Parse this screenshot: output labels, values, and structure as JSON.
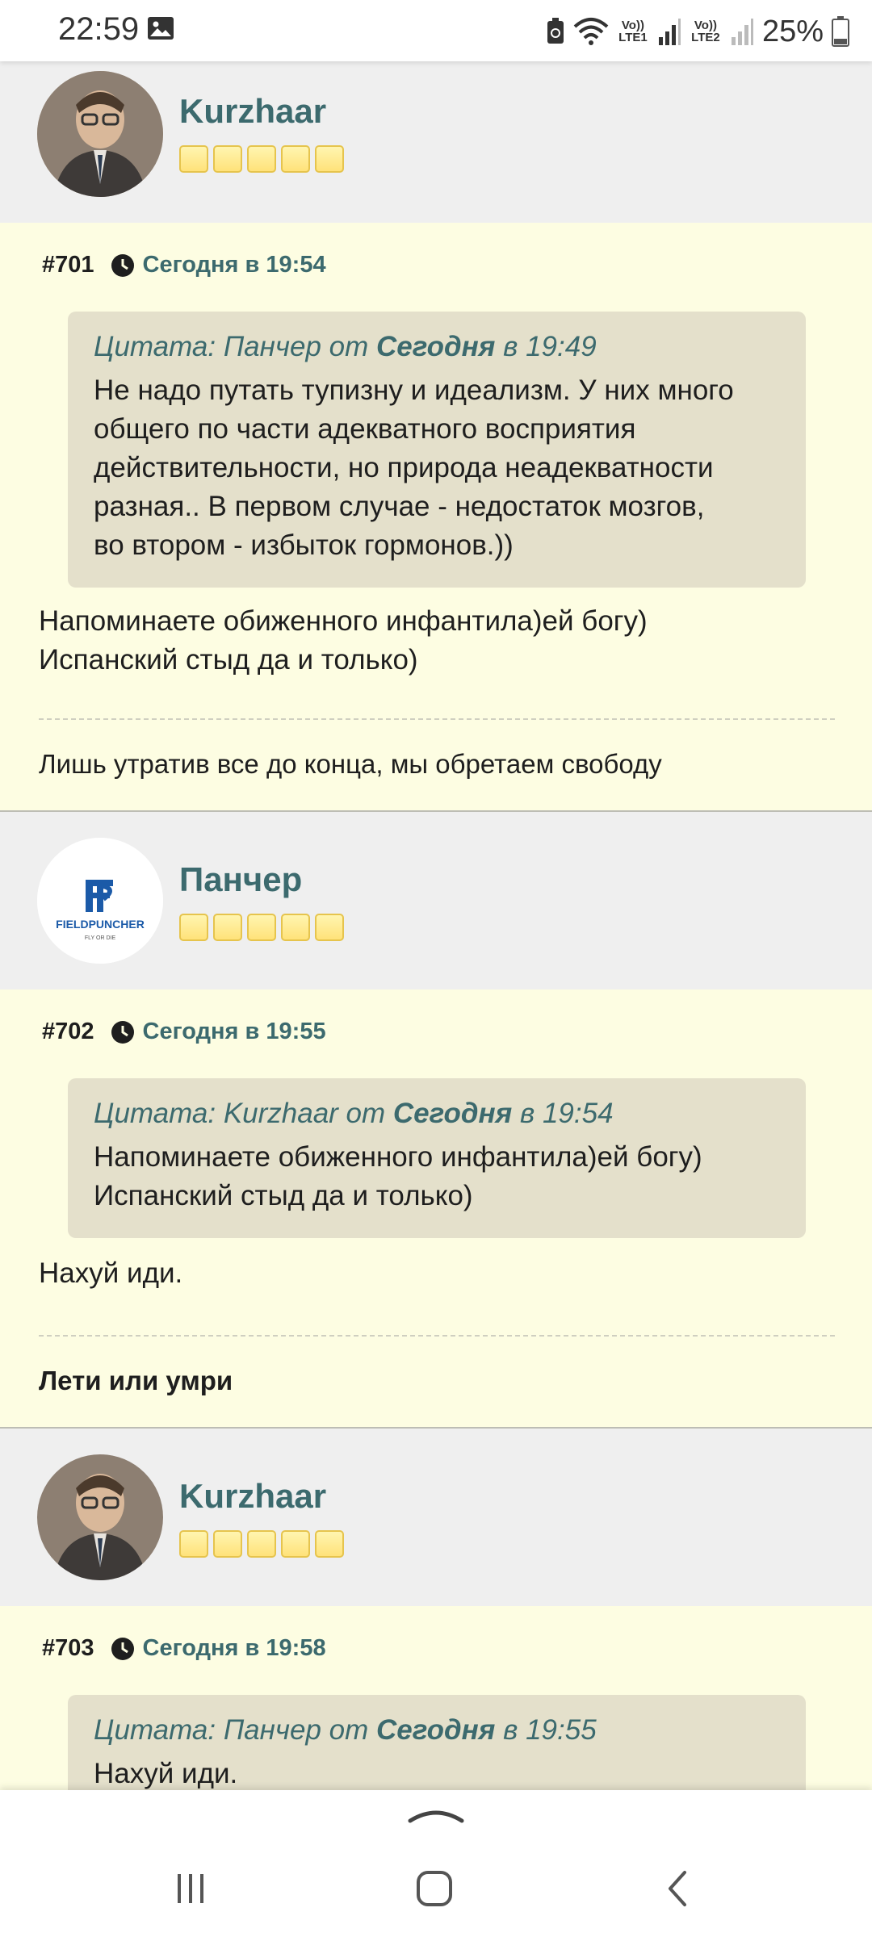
{
  "status_bar": {
    "time": "22:59",
    "net1": "Vo)) LTE1",
    "net2": "Vo)) LTE2",
    "battery": "25%"
  },
  "posts": [
    {
      "author": "Kurzhaar",
      "rating_stars": 5,
      "number": "#701",
      "date": "Сегодня в 19:54",
      "quote": {
        "prefix": "Цитата: Панчер от ",
        "date_bold": "Сегодня",
        "time": " в 19:49",
        "lines": [
          "Не надо путать тупизну и идеализм. У них много",
          "общего по части адекватного восприятия",
          "действительности, но природа неадекватности",
          "разная.. В первом случае - недостаток мозгов,",
          "во втором - избыток гормонов.))"
        ]
      },
      "text_lines": [
        "Напоминаете обиженного инфантила)ей богу)",
        "Испанский стыд да и только)"
      ],
      "signature": "Лишь утратив все до конца, мы обретаем свободу"
    },
    {
      "author": "Панчер",
      "rating_stars": 5,
      "avatar_logo_text": "FIELDPUNCHER",
      "avatar_logo_sub": "FLY OR DIE",
      "number": "#702",
      "date": "Сегодня в 19:55",
      "quote": {
        "prefix": "Цитата: Kurzhaar от ",
        "date_bold": "Сегодня",
        "time": " в 19:54",
        "lines": [
          "Напоминаете обиженного инфантила)ей богу)",
          "Испанский стыд да и только)"
        ]
      },
      "text_lines": [
        "Нахуй иди."
      ],
      "signature": "Лети или умри"
    },
    {
      "author": "Kurzhaar",
      "rating_stars": 5,
      "number": "#703",
      "date": "Сегодня в 19:58",
      "quote": {
        "prefix": "Цитата: Панчер от ",
        "date_bold": "Сегодня",
        "time": " в 19:55",
        "lines": [
          "Нахуй иди."
        ]
      }
    }
  ],
  "colors": {
    "accent": "#3c6a6e",
    "post_bg": "#fdfde2",
    "author_bg": "#efefef",
    "quote_bg": "#e4e0cb"
  }
}
